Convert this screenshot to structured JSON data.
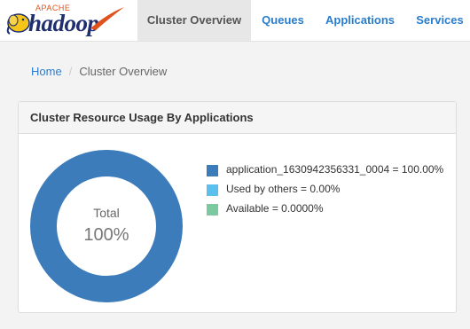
{
  "logo": {
    "top_text": "APACHE",
    "word": "hadoop"
  },
  "nav": {
    "tabs": [
      {
        "label": "Cluster Overview",
        "active": true
      },
      {
        "label": "Queues",
        "active": false
      },
      {
        "label": "Applications",
        "active": false
      },
      {
        "label": "Services",
        "active": false
      }
    ]
  },
  "breadcrumb": {
    "home": "Home",
    "separator": "/",
    "current": "Cluster Overview"
  },
  "panel": {
    "title": "Cluster Resource Usage By Applications",
    "donut": {
      "center_label": "Total",
      "center_value": "100%"
    },
    "legend": [
      {
        "label": "application_1630942356331_0004 = 100.00%",
        "color": "#3c7cba"
      },
      {
        "label": "Used by others = 0.00%",
        "color": "#5bc0eb"
      },
      {
        "label": "Available = 0.0000%",
        "color": "#7cc9a0"
      }
    ]
  },
  "colors": {
    "accent": "#2a7dcd",
    "donut_fill": "#3c7cba"
  }
}
